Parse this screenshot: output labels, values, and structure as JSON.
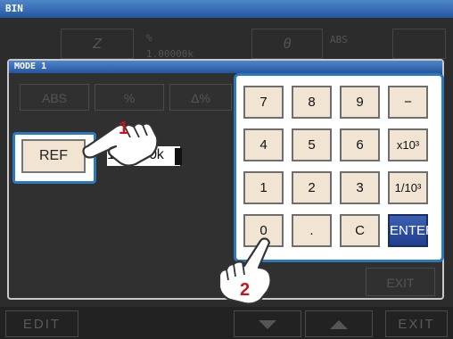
{
  "window": {
    "title": "BIN"
  },
  "background": {
    "param_z": "Z",
    "unit_pct": "%",
    "nominal_value": "1.00000k",
    "param_theta": "θ",
    "mode_abs": "ABS"
  },
  "dialog": {
    "title": "MODE 1",
    "tabs": [
      "ABS",
      "%",
      "Δ%"
    ],
    "ref_label": "REF",
    "ref_value": "1.00000k",
    "exit_label": "EXIT"
  },
  "keypad": {
    "keys": [
      "7",
      "8",
      "9",
      "−",
      "4",
      "5",
      "6",
      "x10³",
      "1",
      "2",
      "3",
      "1/10³",
      "0",
      ".",
      "C",
      "ENTER"
    ]
  },
  "callouts": {
    "step1": "1",
    "step2": "2"
  },
  "bottom_bar": {
    "edit_label": "EDIT",
    "down_icon": "down-arrow-icon",
    "up_icon": "up-arrow-icon",
    "exit_label": "EXIT"
  },
  "colors": {
    "highlight": "#2a78c0",
    "key_face": "#f1e4d2",
    "enter_key": "#2a4ea2",
    "step_number": "#c4161c"
  }
}
